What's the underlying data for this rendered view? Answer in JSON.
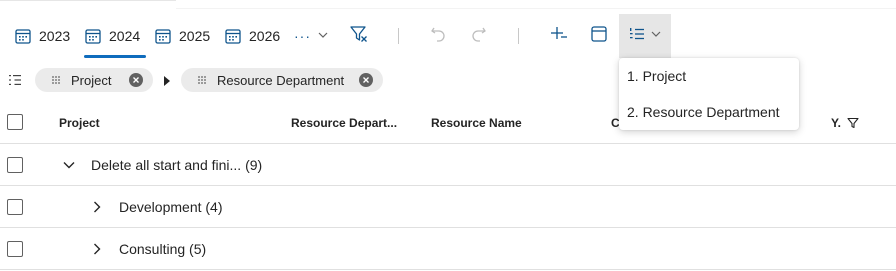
{
  "toolbar": {
    "years": [
      {
        "label": "2023",
        "active": false
      },
      {
        "label": "2024",
        "active": true
      },
      {
        "label": "2025",
        "active": false
      },
      {
        "label": "2026",
        "active": false
      }
    ],
    "more_label": "···"
  },
  "chips": [
    {
      "label": "Project"
    },
    {
      "label": "Resource Department"
    }
  ],
  "table": {
    "columns": [
      "Project",
      "Resource Depart...",
      "Resource Name",
      "C",
      "Y."
    ],
    "rows": [
      {
        "label": "Delete all start and fini...",
        "count": "(9)",
        "expanded": true
      },
      {
        "label": "Development",
        "count": "(4)",
        "expanded": false
      },
      {
        "label": "Consulting",
        "count": "(5)",
        "expanded": false
      }
    ]
  },
  "groupby_menu": {
    "items": [
      "1. Project",
      "2. Resource Department"
    ]
  },
  "colors": {
    "accent": "#0f6cbd",
    "icon": "#0f548c",
    "disabled": "#bdbdbd"
  }
}
